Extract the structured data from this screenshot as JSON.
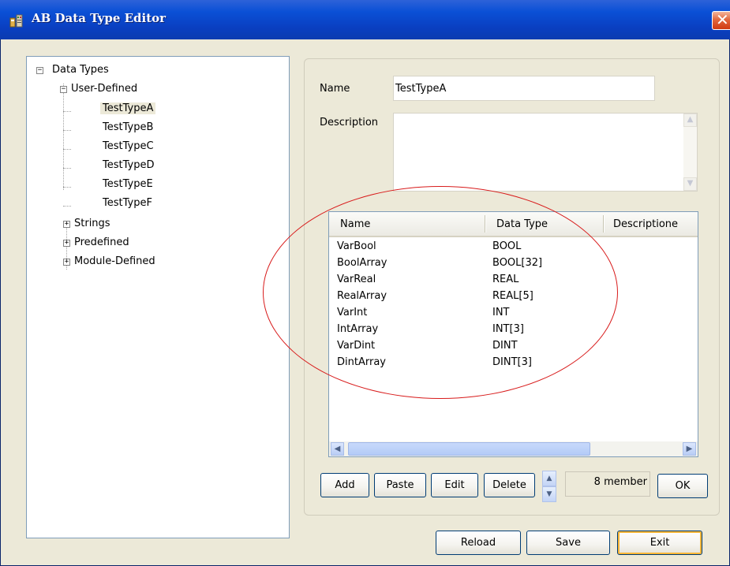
{
  "window": {
    "title": "AB Data Type Editor",
    "close_glyph": "✕"
  },
  "tree": {
    "root": "Data Types",
    "user_defined": "User-Defined",
    "types": [
      "TestTypeA",
      "TestTypeB",
      "TestTypeC",
      "TestTypeD",
      "TestTypeE",
      "TestTypeF"
    ],
    "selected": "TestTypeA",
    "strings": "Strings",
    "predefined": "Predefined",
    "module_defined": "Module-Defined"
  },
  "form": {
    "name_label": "Name",
    "name_value": "TestTypeA",
    "description_label": "Description",
    "description_value": ""
  },
  "grid": {
    "columns": [
      "Name",
      "Data Type",
      "Descriptione"
    ],
    "rows": [
      {
        "name": "VarBool",
        "type": "BOOL"
      },
      {
        "name": "BoolArray",
        "type": "BOOL[32]"
      },
      {
        "name": "VarReal",
        "type": "REAL"
      },
      {
        "name": "RealArray",
        "type": "REAL[5]"
      },
      {
        "name": "VarInt",
        "type": "INT"
      },
      {
        "name": "IntArray",
        "type": "INT[3]"
      },
      {
        "name": "VarDint",
        "type": "DINT"
      },
      {
        "name": "DintArray",
        "type": "DINT[3]"
      }
    ]
  },
  "toolbar": {
    "add": "Add",
    "paste": "Paste",
    "edit": "Edit",
    "delete": "Delete",
    "member_count": "8 member",
    "ok": "OK"
  },
  "footer": {
    "reload": "Reload",
    "save": "Save",
    "exit": "Exit"
  },
  "colors": {
    "titlebar": "#0a50d6",
    "window_bg": "#ece9d8",
    "annotation": "#d81b1b"
  }
}
